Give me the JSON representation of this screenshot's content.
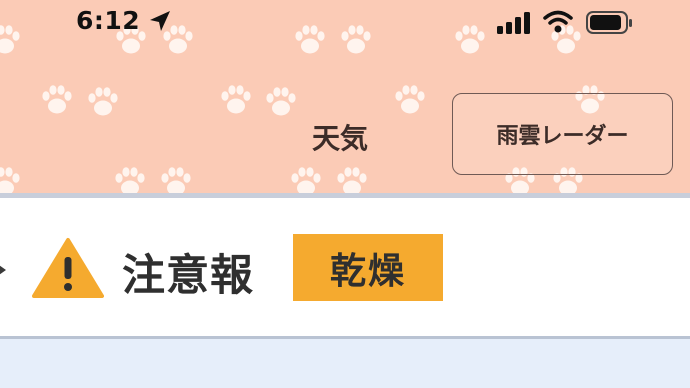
{
  "status_bar": {
    "time": "6:12",
    "location_icon": "location-arrow-icon",
    "signal_icon": "cellular-signal-icon",
    "wifi_icon": "wifi-icon",
    "battery_icon": "battery-icon"
  },
  "header": {
    "title": "天気",
    "radar_button_label": "雨雲レーダー",
    "background_color": "#fbcbb6",
    "pattern": "paw-print-pattern"
  },
  "alert": {
    "level": "注意報",
    "type": "乾燥",
    "badge_color": "#f5aa2f",
    "icon": "warning-icon"
  }
}
